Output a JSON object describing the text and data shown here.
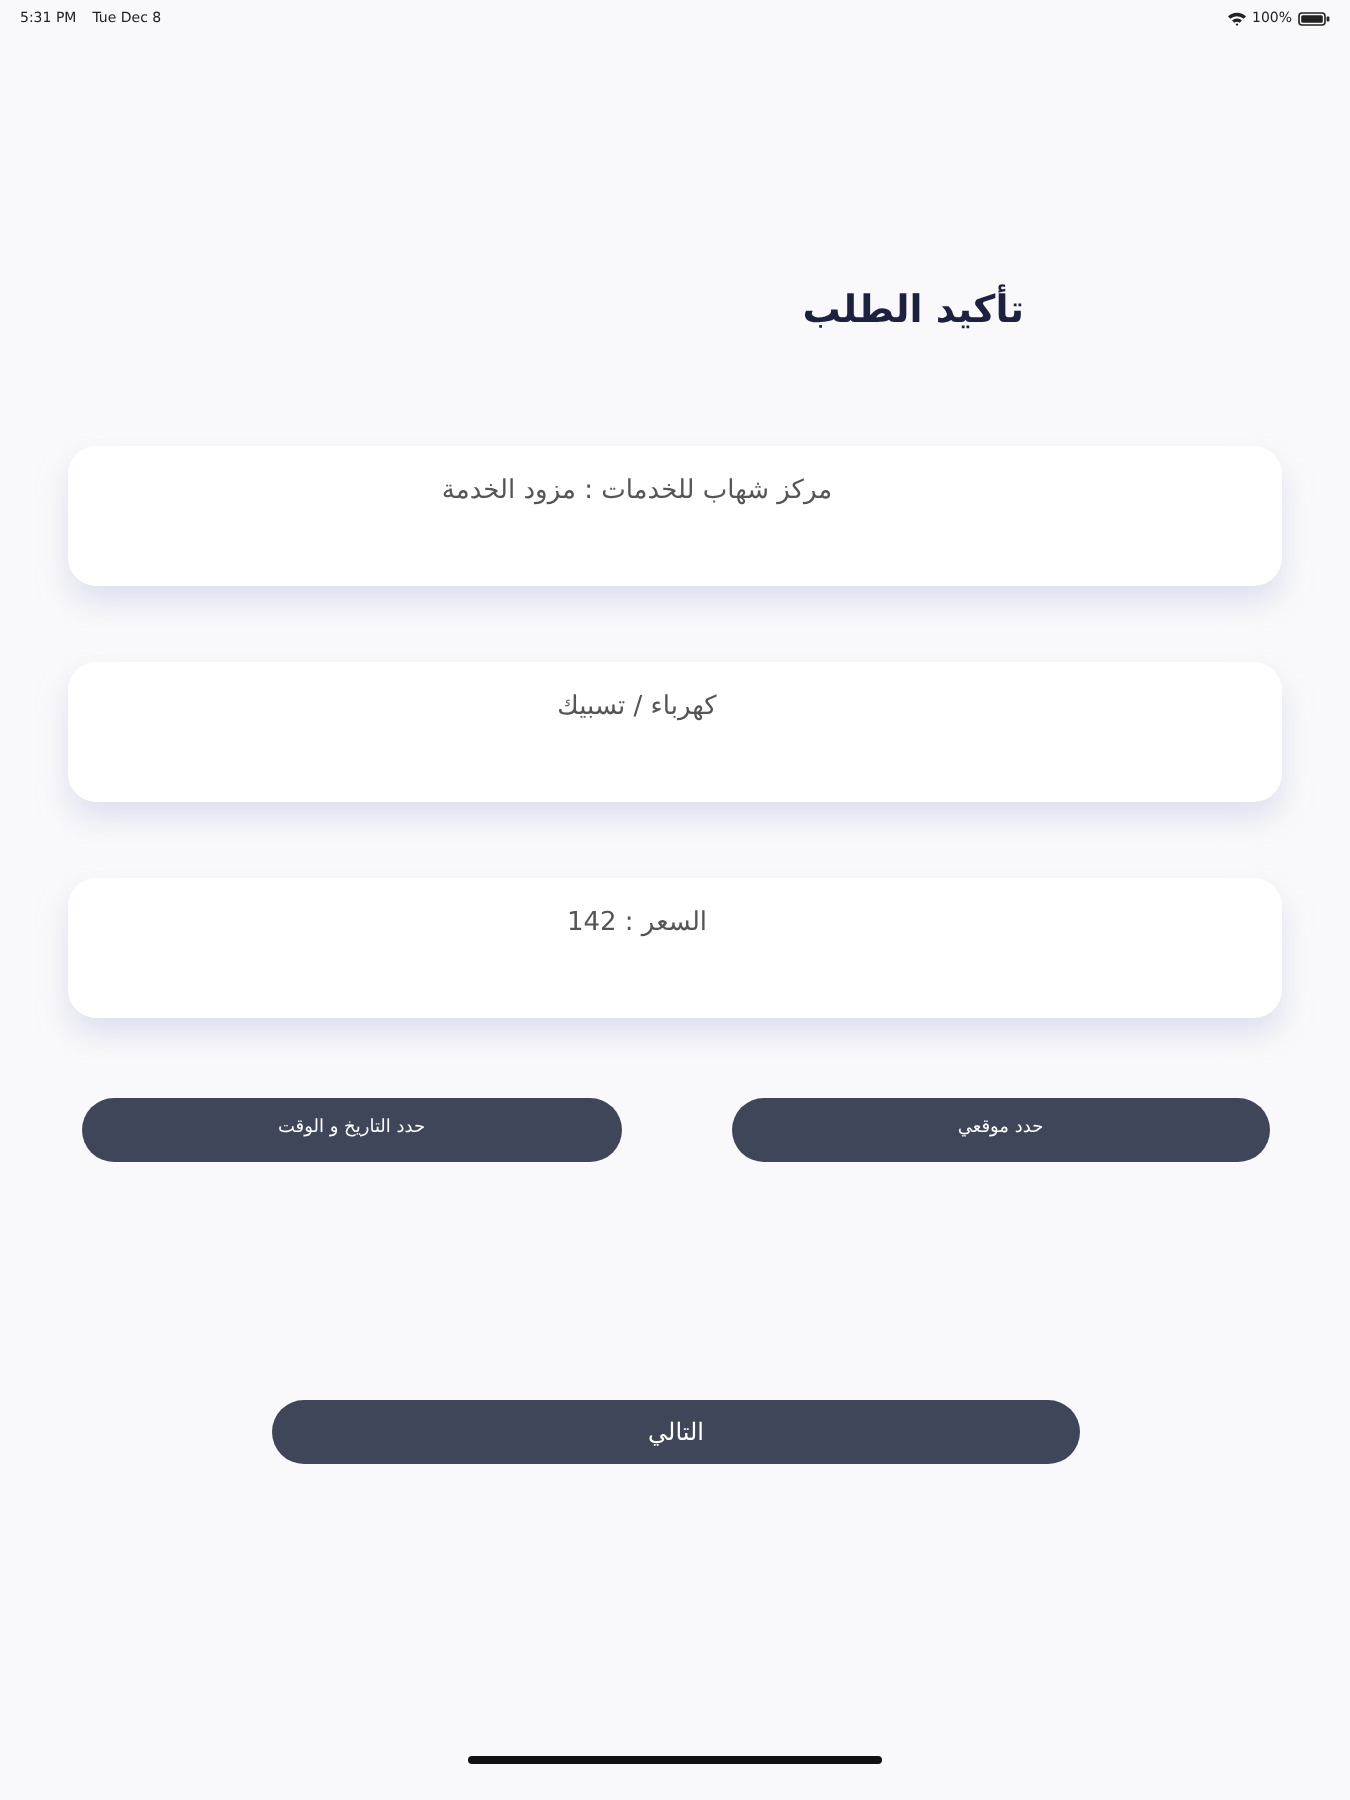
{
  "status_bar": {
    "time": "5:31 PM",
    "date": "Tue Dec 8",
    "battery": "100%"
  },
  "title": "تأكيد الطلب",
  "cards": [
    {
      "text": "مركز شهاب للخدمات : مزود الخدمة"
    },
    {
      "text": "كهرباء / تسبيك"
    },
    {
      "text": "السعر : 142"
    }
  ],
  "actions": [
    "حدد موقعي",
    "حدد التاريخ و الوقت"
  ],
  "next_button": "التالي"
}
